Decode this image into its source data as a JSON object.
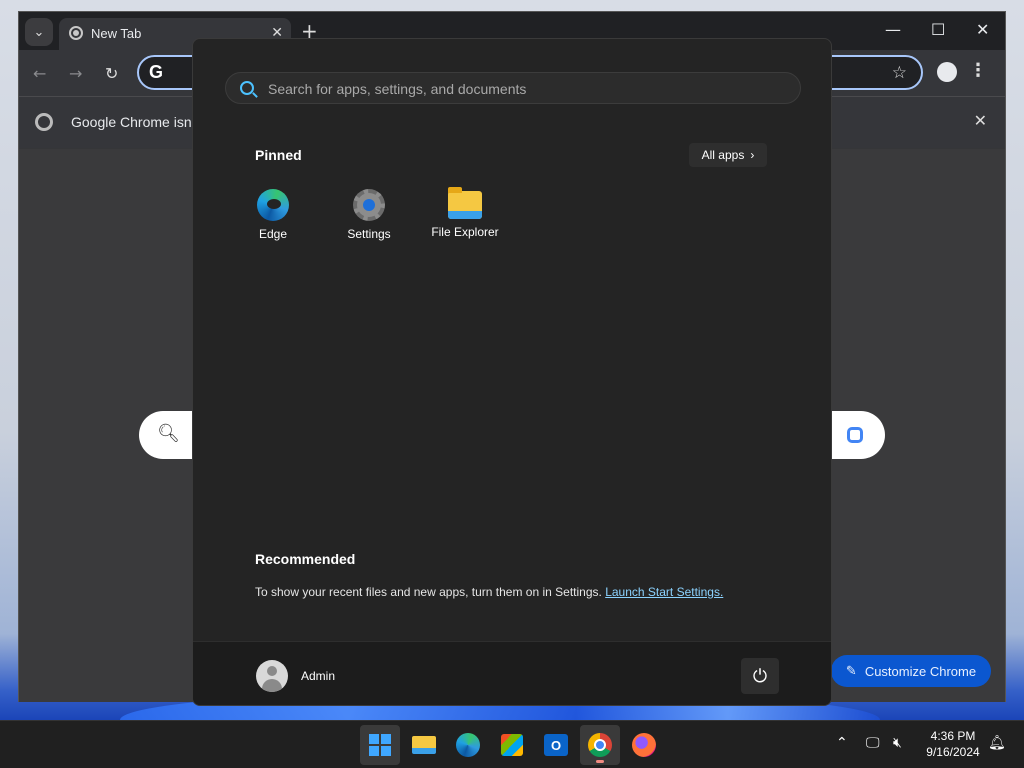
{
  "browser": {
    "tab_title": "New Tab",
    "infobar_text": "Google Chrome isn't",
    "customize_label": "Customize Chrome"
  },
  "start_menu": {
    "search_placeholder": "Search for apps, settings, and documents",
    "pinned_title": "Pinned",
    "all_apps_label": "All apps",
    "pinned_apps": [
      {
        "label": "Edge",
        "icon": "edge-icon"
      },
      {
        "label": "Settings",
        "icon": "settings-icon"
      },
      {
        "label": "File Explorer",
        "icon": "file-explorer-icon"
      }
    ],
    "recommended_title": "Recommended",
    "recommended_text": "To show your recent files and new apps, turn them on in Settings.",
    "recommended_link": "Launch Start Settings.",
    "user_name": "Admin"
  },
  "taskbar": {
    "items": [
      "start-icon",
      "file-explorer-icon",
      "edge-icon",
      "store-icon",
      "outlook-icon",
      "chrome-icon",
      "firefox-icon"
    ],
    "time": "4:36 PM",
    "date": "9/16/2024"
  },
  "colors": {
    "start_bg": "#242424",
    "accent": "#4cc2ff",
    "link": "#8cd3ff",
    "chrome_button": "#0b57d0"
  }
}
